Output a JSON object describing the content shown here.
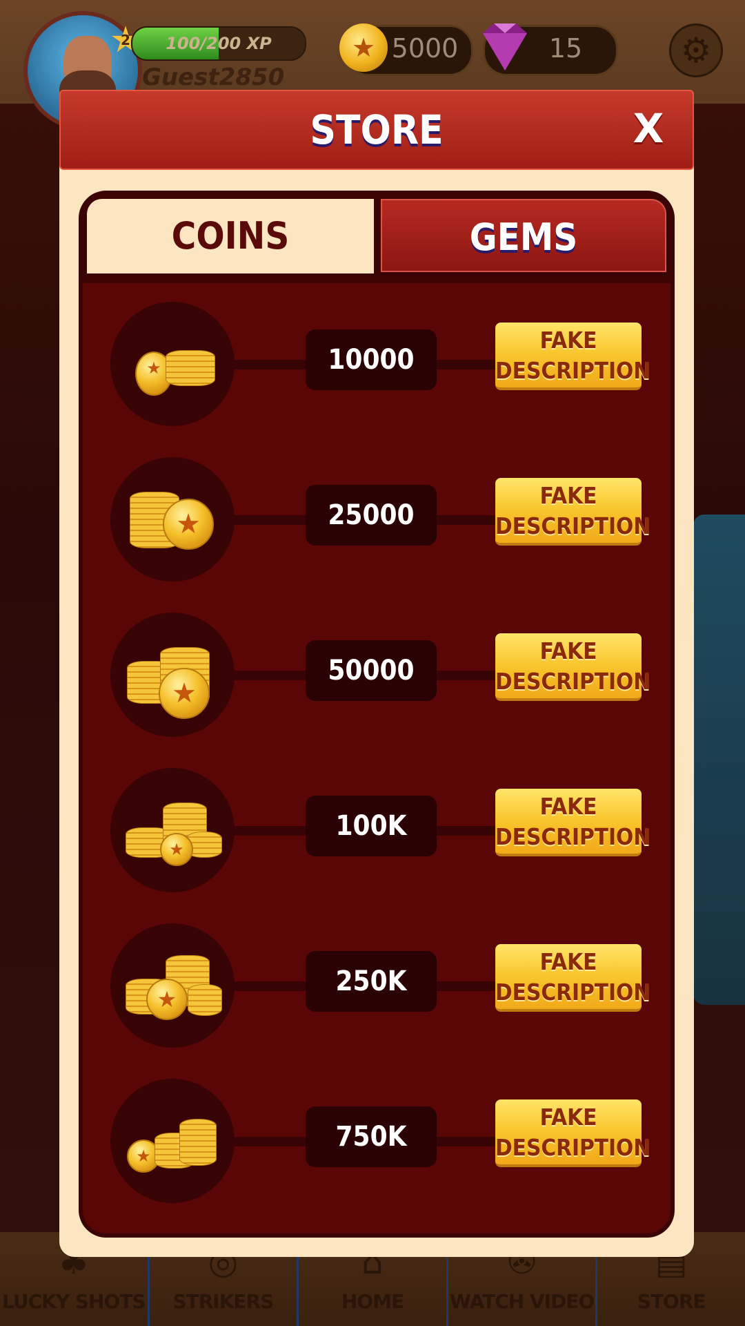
{
  "player": {
    "level": "2",
    "xp_text": "100/200 XP",
    "xp_progress": 0.5,
    "username": "Guest2850"
  },
  "currency": {
    "coins": "5000",
    "gems": "15"
  },
  "store": {
    "title": "STORE",
    "close_label": "X",
    "tabs": {
      "coins": "COINS",
      "gems": "GEMS"
    },
    "items": [
      {
        "amount": "10000",
        "button_line1": "FAKE",
        "button_line2": "DESCRIPTION"
      },
      {
        "amount": "25000",
        "button_line1": "FAKE",
        "button_line2": "DESCRIPTION"
      },
      {
        "amount": "50000",
        "button_line1": "FAKE",
        "button_line2": "DESCRIPTION"
      },
      {
        "amount": "100K",
        "button_line1": "FAKE",
        "button_line2": "DESCRIPTION"
      },
      {
        "amount": "250K",
        "button_line1": "FAKE",
        "button_line2": "DESCRIPTION"
      },
      {
        "amount": "750K",
        "button_line1": "FAKE",
        "button_line2": "DESCRIPTION"
      }
    ]
  },
  "bottom_nav": [
    {
      "label": "LUCKY SHOTS",
      "icon": "clover-icon"
    },
    {
      "label": "STRIKERS",
      "icon": "striker-icon"
    },
    {
      "label": "HOME",
      "icon": "home-icon"
    },
    {
      "label": "WATCH VIDEO",
      "icon": "film-reel-icon"
    },
    {
      "label": "STORE",
      "icon": "store-icon"
    }
  ],
  "colors": {
    "header_red": "#b62a22",
    "panel_dark_red": "#5a0506",
    "cream": "#fce6c1",
    "button_gold": "#f8c52c"
  }
}
